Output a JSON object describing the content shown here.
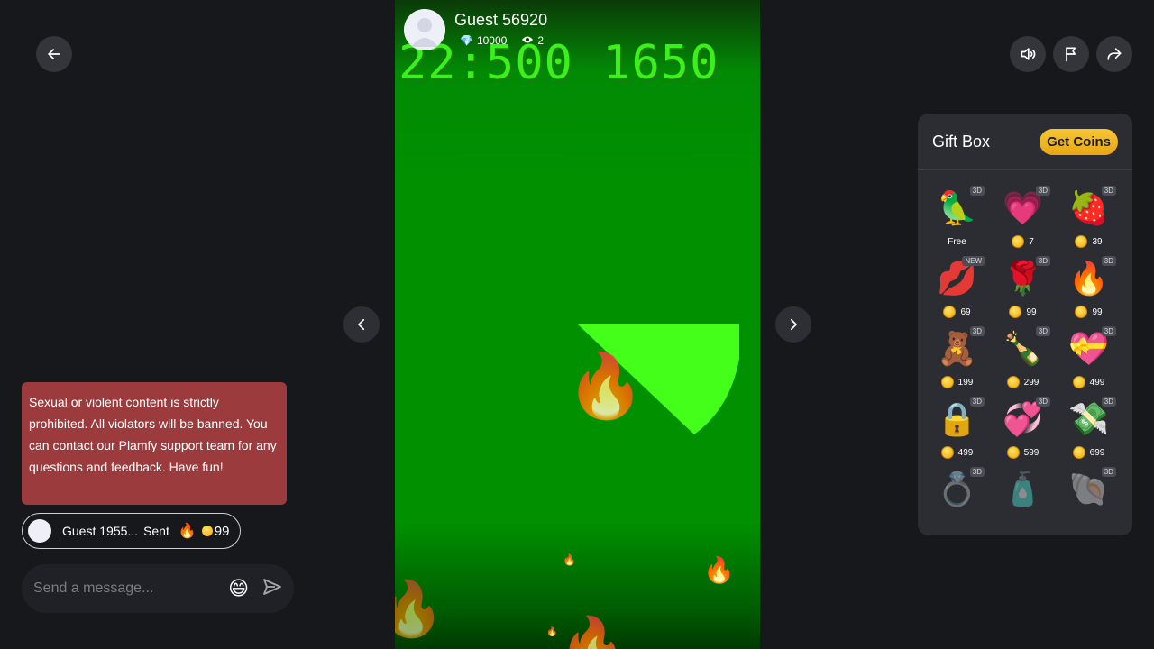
{
  "streamer": {
    "name": "Guest 56920",
    "diamonds": "10000",
    "viewers": "2"
  },
  "game": {
    "score_text": "22:500 1650"
  },
  "notice": {
    "text": "Sexual or violent content is strictly prohibited. All violators will be banned. You can contact our Plamfy support team for any questions and feedback. Have fun!"
  },
  "gift_message": {
    "user": "Guest 1955...",
    "action": "Sent",
    "gift_emoji": "🔥",
    "amount": "99"
  },
  "message_input": {
    "placeholder": "Send a message...",
    "emoji": "😄"
  },
  "gift_box": {
    "title": "Gift Box",
    "get_coins_label": "Get Coins",
    "gifts": [
      {
        "emoji": "🦜",
        "badge": "3D",
        "price": "Free",
        "coin": false
      },
      {
        "emoji": "💗",
        "badge": "3D",
        "price": "7",
        "coin": true
      },
      {
        "emoji": "🍓",
        "badge": "3D",
        "price": "39",
        "coin": true
      },
      {
        "emoji": "💋",
        "badge": "NEW",
        "price": "69",
        "coin": true
      },
      {
        "emoji": "🌹",
        "badge": "3D",
        "price": "99",
        "coin": true
      },
      {
        "emoji": "🔥",
        "badge": "3D",
        "price": "99",
        "coin": true
      },
      {
        "emoji": "🧸",
        "badge": "3D",
        "price": "199",
        "coin": true
      },
      {
        "emoji": "🍾",
        "badge": "3D",
        "price": "299",
        "coin": true
      },
      {
        "emoji": "💝",
        "badge": "3D",
        "price": "499",
        "coin": true
      },
      {
        "emoji": "🔒",
        "badge": "3D",
        "price": "499",
        "coin": true
      },
      {
        "emoji": "💞",
        "badge": "3D",
        "price": "599",
        "coin": true
      },
      {
        "emoji": "💸",
        "badge": "3D",
        "price": "699",
        "coin": true
      },
      {
        "emoji": "💍",
        "badge": "3D",
        "price": "",
        "coin": false
      },
      {
        "emoji": "🧴",
        "badge": "",
        "price": "",
        "coin": false
      },
      {
        "emoji": "🐚",
        "badge": "3D",
        "price": "",
        "coin": false
      }
    ]
  },
  "icons": {
    "back": "arrow-left-icon",
    "sound": "speaker-icon",
    "report": "flag-icon",
    "share": "share-icon",
    "prev": "chevron-left-icon",
    "next": "chevron-right-icon",
    "send": "send-icon",
    "diamond": "diamond-icon",
    "eye": "eye-icon"
  }
}
